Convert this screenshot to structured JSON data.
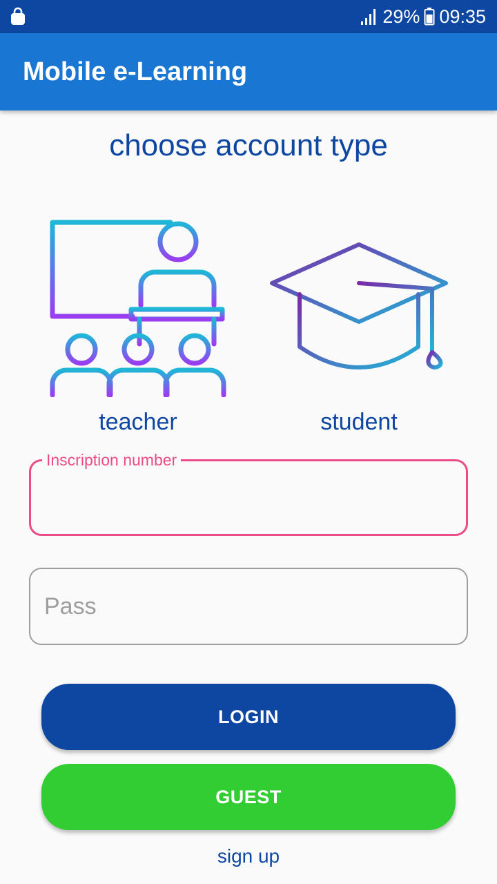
{
  "status_bar": {
    "signal": "29%",
    "time": "09:35"
  },
  "app_bar": {
    "title": "Mobile e-Learning"
  },
  "main": {
    "heading": "choose account type",
    "account_types": [
      {
        "label": "teacher",
        "icon": "teacher-classroom-icon"
      },
      {
        "label": "student",
        "icon": "graduation-cap-icon"
      }
    ],
    "inscription_field": {
      "label": "Inscription number",
      "value": ""
    },
    "pass_field": {
      "placeholder": "Pass",
      "value": ""
    },
    "login_button": "LOGIN",
    "guest_button": "GUEST",
    "signup_link": "sign up"
  },
  "colors": {
    "status_bar": "#0d47a1",
    "app_bar": "#1976d2",
    "primary_text": "#0d47a1",
    "focus_accent": "#ec4c85",
    "login_button": "#0d47a1",
    "guest_button": "#32cd32",
    "icon_gradient_start": "#1fb6d8",
    "icon_gradient_end": "#9a3df0"
  }
}
